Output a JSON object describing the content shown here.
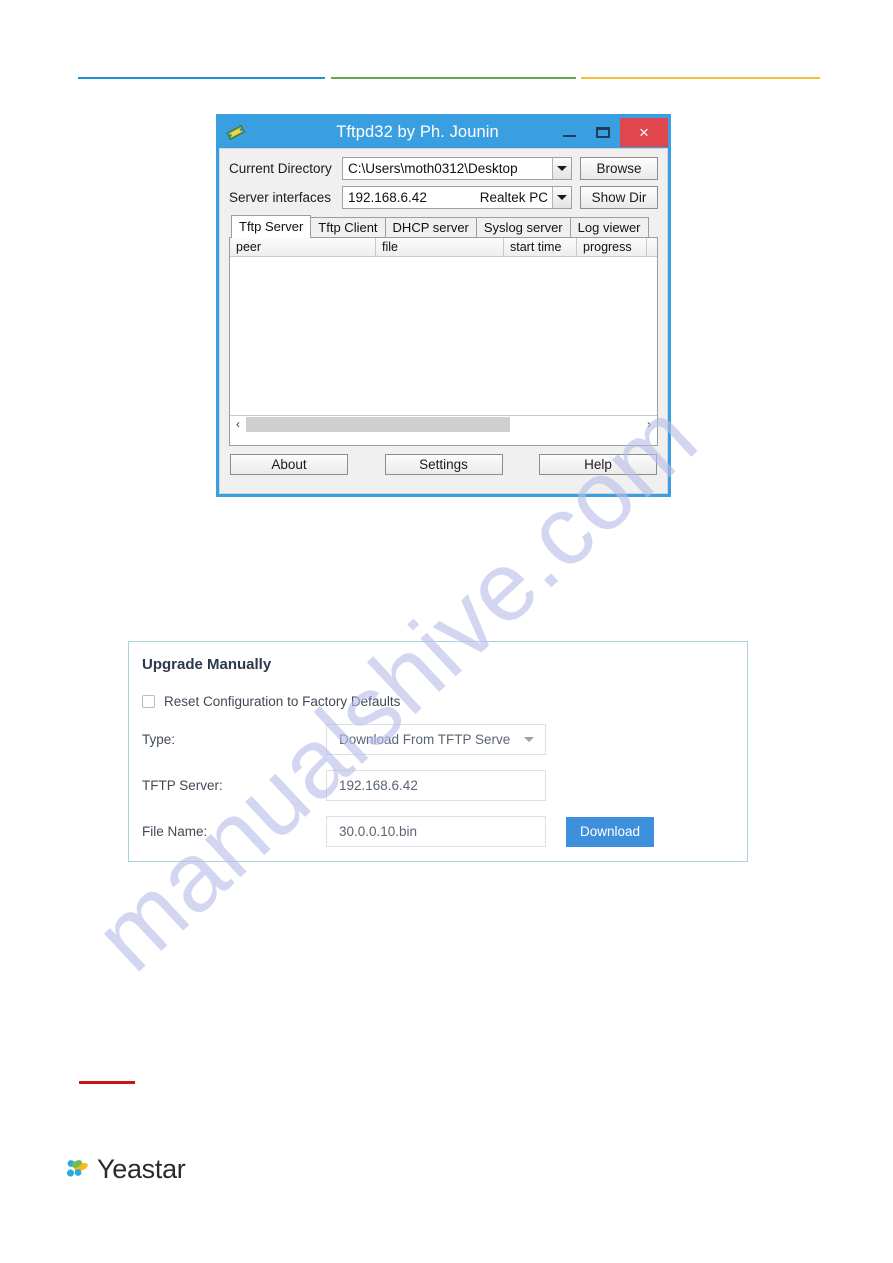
{
  "header_rules": {
    "blue": "#1a95d6",
    "green": "#6aa64b",
    "yellow": "#f5c232"
  },
  "watermark": {
    "text": "manualshive.com",
    "color": "#b9bde8"
  },
  "tftp_window": {
    "title": "Tftpd32 by Ph. Jounin",
    "app_icon": "tftpd-icon",
    "window_controls": {
      "minimize": "minimize-icon",
      "maximize": "maximize-icon",
      "close": "×"
    },
    "frame_color": "#3a9fe0",
    "close_color": "#e0474c",
    "fields": [
      {
        "label": "Current Directory",
        "value": "C:\\Users\\moth0312\\Desktop",
        "value_right": "",
        "button": "Browse"
      },
      {
        "label": "Server interfaces",
        "value": "192.168.6.42",
        "value_right": "Realtek PC",
        "button": "Show Dir"
      }
    ],
    "tabs": [
      {
        "label": "Tftp Server",
        "active": true
      },
      {
        "label": "Tftp Client",
        "active": false
      },
      {
        "label": "DHCP server",
        "active": false
      },
      {
        "label": "Syslog server",
        "active": false
      },
      {
        "label": "Log viewer",
        "active": false
      }
    ],
    "list_columns": [
      "peer",
      "file",
      "start time",
      "progress"
    ],
    "list_rows": [],
    "scrollbar": {
      "left_arrow": "‹",
      "right_arrow": "›"
    },
    "bottom_buttons": [
      "About",
      "Settings",
      "Help"
    ]
  },
  "upgrade_panel": {
    "title": "Upgrade Manually",
    "checkbox": {
      "label": "Reset Configuration to Factory Defaults",
      "checked": false
    },
    "rows": [
      {
        "label": "Type:",
        "value": "Download From TFTP Serve",
        "kind": "select"
      },
      {
        "label": "TFTP Server:",
        "value": "192.168.6.42",
        "kind": "input"
      },
      {
        "label": "File Name:",
        "value": "30.0.0.10.bin",
        "kind": "input"
      }
    ],
    "download_button": "Download",
    "accent_color": "#3e8fdc",
    "border_color": "#a9d5da"
  },
  "footer": {
    "red_rule_color": "#cc1414",
    "brand": "Yeastar",
    "logo_colors": [
      "#2fa8e0",
      "#6fbf4a",
      "#f5b921",
      "#f58220"
    ]
  }
}
